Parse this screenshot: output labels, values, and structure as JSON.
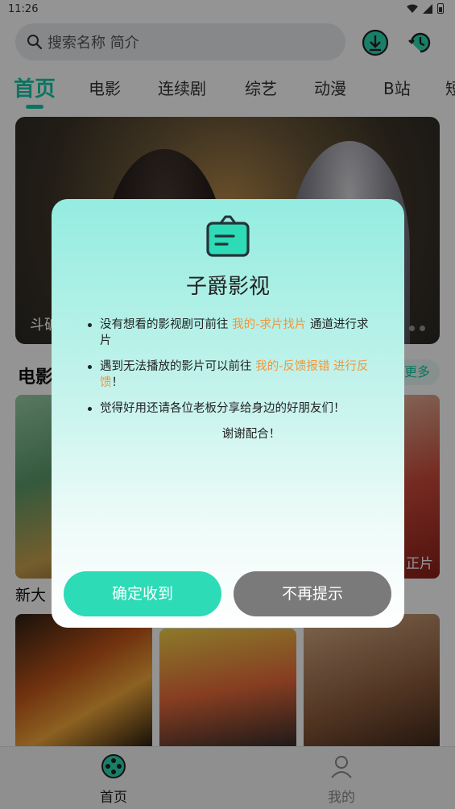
{
  "status_bar": {
    "time": "11:26"
  },
  "search": {
    "placeholder": "搜索名称 简介"
  },
  "tabs": [
    {
      "label": "首页",
      "active": true
    },
    {
      "label": "电影"
    },
    {
      "label": "连续剧"
    },
    {
      "label": "综艺"
    },
    {
      "label": "动漫"
    },
    {
      "label": "B站"
    },
    {
      "label": "短"
    }
  ],
  "banner": {
    "caption": "斗破"
  },
  "section": {
    "title": "电影",
    "more_label": "更多"
  },
  "movies": [
    {
      "name": "新大"
    },
    {
      "tag": "正片"
    }
  ],
  "bottom_nav": [
    {
      "label": "首页",
      "active": true
    },
    {
      "label": "我的"
    }
  ],
  "dialog": {
    "title": "子爵影视",
    "items": [
      {
        "before": "没有想看的影视剧可前往 ",
        "highlight": "我的-求片找片",
        "after": " 通道进行求片"
      },
      {
        "before": "遇到无法播放的影片可以前往 ",
        "highlight": "我的-反馈报错 进行反馈",
        "after": "！"
      },
      {
        "before": "觉得好用还请各位老板分享给身边的好朋友们！",
        "highlight": "",
        "after": ""
      }
    ],
    "thanks": "谢谢配合！",
    "confirm_label": "确定收到",
    "dismiss_label": "不再提示"
  },
  "colors": {
    "accent": "#14c9a6",
    "confirm_button": "#2ddbb6",
    "dismiss_button": "#7a7a7a",
    "highlight_text": "#f2963a"
  }
}
